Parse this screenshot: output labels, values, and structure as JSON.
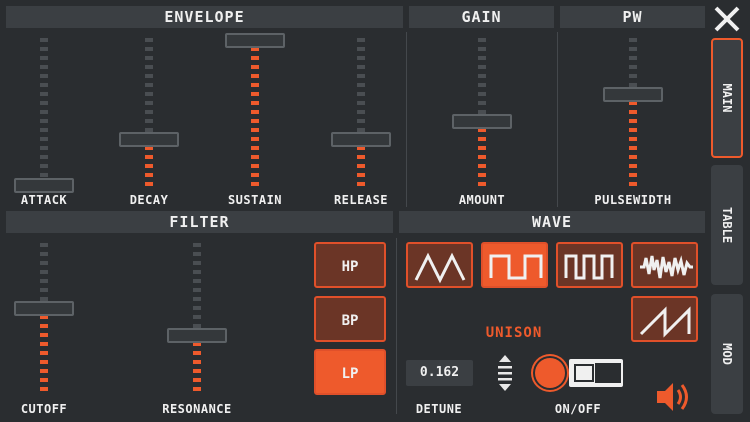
{
  "sections": {
    "envelope": "ENVELOPE",
    "gain": "GAIN",
    "pw": "PW",
    "filter": "FILTER",
    "wave": "WAVE"
  },
  "sliders": {
    "attack": {
      "label": "ATTACK",
      "value": 0.0
    },
    "decay": {
      "label": "DECAY",
      "value": 0.31
    },
    "sustain": {
      "label": "SUSTAIN",
      "value": 0.94
    },
    "release": {
      "label": "RELEASE",
      "value": 0.31
    },
    "amount": {
      "label": "AMOUNT",
      "value": 0.44
    },
    "pulsewidth": {
      "label": "PULSEWIDTH",
      "value": 0.56
    },
    "cutoff": {
      "label": "CUTOFF",
      "value": 0.54
    },
    "resonance": {
      "label": "RESONANCE",
      "value": 0.38
    }
  },
  "filter": {
    "buttons": [
      "HP",
      "BP",
      "LP"
    ],
    "selected": "LP"
  },
  "wave": {
    "shapes": [
      "triangle",
      "square",
      "pulse",
      "noise",
      "sawtooth"
    ],
    "selected": "square"
  },
  "unison": {
    "title": "UNISON",
    "detune_value": "0.162",
    "detune_label": "DETUNE",
    "onoff_label": "ON/OFF",
    "enabled": false
  },
  "tabs": [
    "MAIN",
    "TABLE",
    "MOD"
  ],
  "active_tab": "MAIN",
  "colors": {
    "accent": "#ee5a2c",
    "background": "#2a2d30",
    "header": "#3b3f43"
  }
}
